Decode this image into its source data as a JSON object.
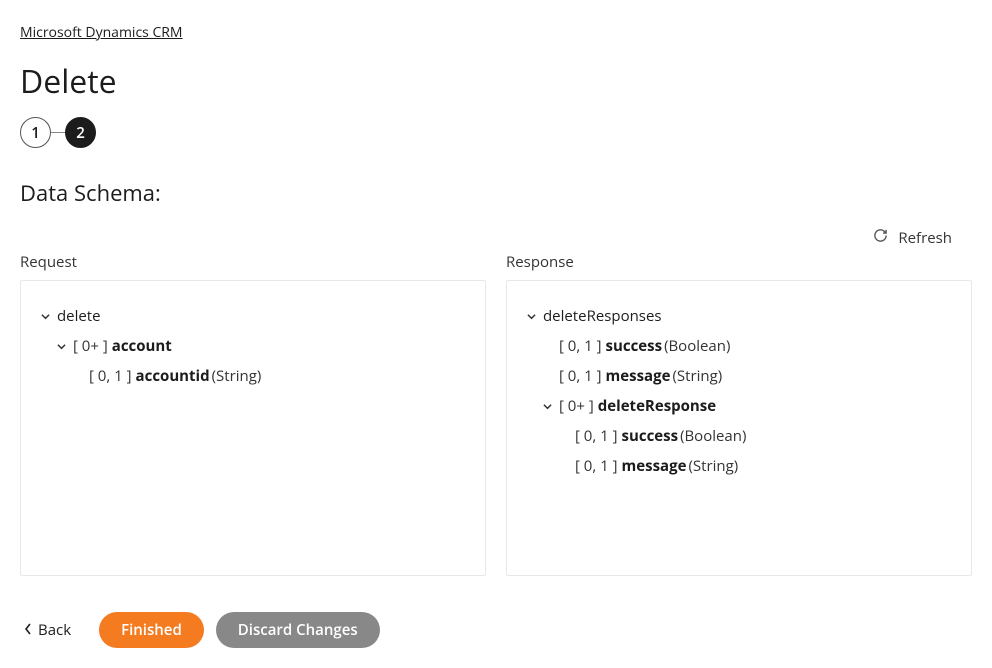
{
  "breadcrumb": "Microsoft Dynamics CRM",
  "title": "Delete",
  "stepper": {
    "step1": "1",
    "step2": "2"
  },
  "section_title": "Data Schema:",
  "refresh_label": "Refresh",
  "panels": {
    "request_label": "Request",
    "response_label": "Response"
  },
  "request_tree": {
    "root": "delete",
    "account_card": "[ 0+ ]",
    "account_name": "account",
    "accountid_card": "[ 0, 1 ]",
    "accountid_name": "accountid",
    "accountid_type": "(String)"
  },
  "response_tree": {
    "root": "deleteResponses",
    "success1_card": "[ 0, 1 ]",
    "success1_name": "success",
    "success1_type": "(Boolean)",
    "message1_card": "[ 0, 1 ]",
    "message1_name": "message",
    "message1_type": "(String)",
    "deleteResponse_card": "[ 0+ ]",
    "deleteResponse_name": "deleteResponse",
    "success2_card": "[ 0, 1 ]",
    "success2_name": "success",
    "success2_type": "(Boolean)",
    "message2_card": "[ 0, 1 ]",
    "message2_name": "message",
    "message2_type": "(String)"
  },
  "buttons": {
    "back": "Back",
    "finished": "Finished",
    "discard": "Discard Changes"
  }
}
